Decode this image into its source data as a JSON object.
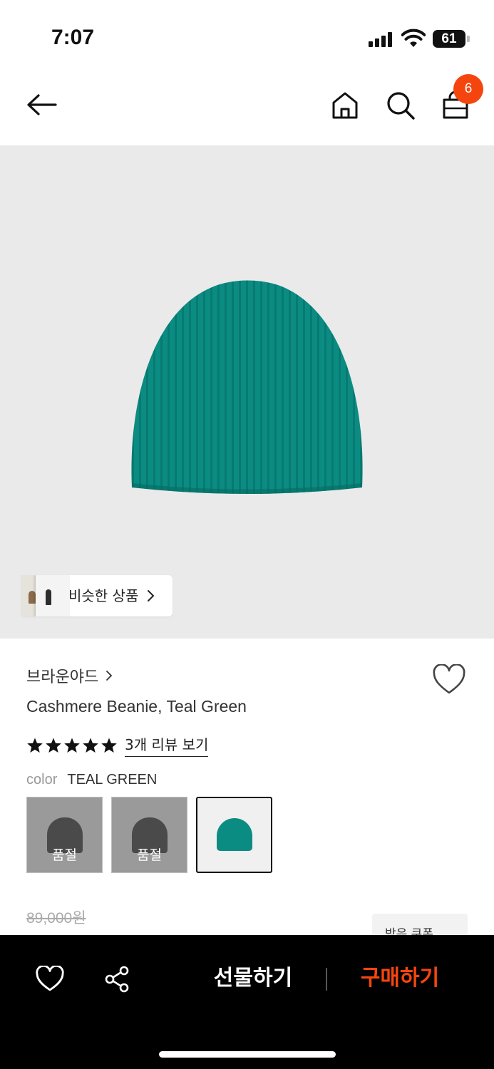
{
  "status_bar": {
    "time": "7:07",
    "battery": "61"
  },
  "header": {
    "cart_count": "6"
  },
  "hero": {
    "similar_products_label": "비슷한 상품"
  },
  "product": {
    "brand": "브라운야드",
    "title": "Cashmere Beanie, Teal Green",
    "rating_stars": 5,
    "review_link": "3개 리뷰 보기",
    "color_label": "color",
    "color_value": "TEAL GREEN",
    "swatches": [
      {
        "status": "품절"
      },
      {
        "status": "품절"
      },
      {
        "status": ""
      }
    ],
    "original_price": "89,000원",
    "coupon_label": "받은 쿠폰"
  },
  "bottom_bar": {
    "gift_label": "선물하기",
    "buy_label": "구매하기"
  },
  "colors": {
    "accent": "#f5450f",
    "product_teal": "#0b8c82",
    "image_bg": "#eaeaea"
  },
  "icons": [
    "back-icon",
    "home-icon",
    "search-icon",
    "shopping-bag-icon",
    "chevron-right-icon",
    "heart-icon",
    "star-icon",
    "share-icon"
  ]
}
